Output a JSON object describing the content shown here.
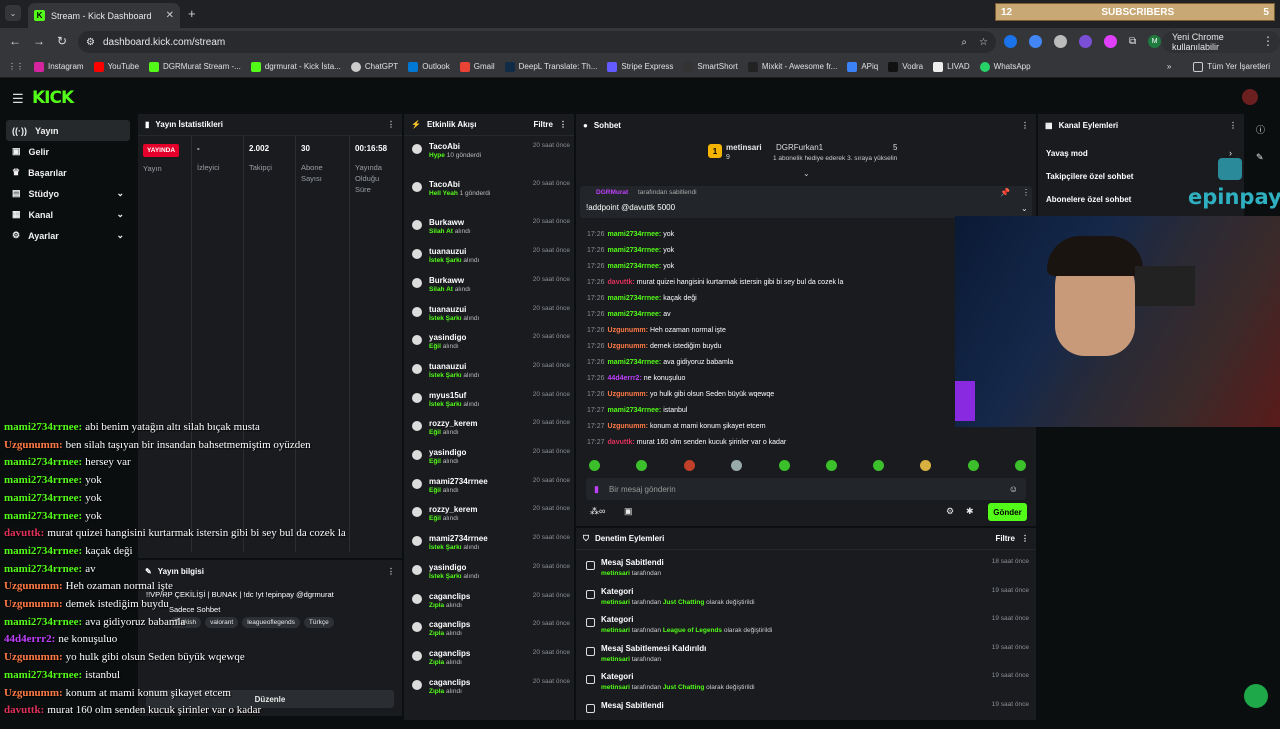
{
  "browser": {
    "tab_title": "Stream - Kick Dashboard",
    "url": "dashboard.kick.com/stream",
    "chrome_user": "Yeni Chrome kullanılabilir",
    "profile_letter": "M",
    "bookmarks": [
      "Instagram",
      "YouTube",
      "DGRMurat Stream -...",
      "dgrmurat - Kick İsta...",
      "ChatGPT",
      "Outlook",
      "Gmail",
      "DeepL Translate: Th...",
      "Stripe Express",
      "SmartShort",
      "Mixkit - Awesome fr...",
      "APiq",
      "Vodra",
      "LIVAD",
      "WhatsApp"
    ],
    "bookmarks_all": "Tüm Yer İşaretleri"
  },
  "overlay_subs": {
    "left": "12",
    "label": "SUBSCRIBERS",
    "right": "5"
  },
  "sidebar": {
    "items": [
      {
        "label": "Yayın"
      },
      {
        "label": "Gelir"
      },
      {
        "label": "Başarılar"
      },
      {
        "label": "Stüdyo"
      },
      {
        "label": "Kanal"
      },
      {
        "label": "Ayarlar"
      }
    ]
  },
  "stats": {
    "title": "Yayın İstatistikleri",
    "live_badge": "YAYINDA",
    "cols": [
      {
        "value": "",
        "label": "Yayın"
      },
      {
        "value": "-",
        "label": "İzleyici"
      },
      {
        "value": "2.002",
        "label": "Takipçi"
      },
      {
        "value": "30",
        "label": "Abone Sayısı"
      },
      {
        "value": "00:16:58",
        "label": "Yayında Olduğu Süre"
      }
    ]
  },
  "stream_info": {
    "title": "Yayın bilgisi",
    "stream_title": "!!VP/RP ÇEKİLİŞİ | BUNAK | !dc !yt !epinpay @dgrmurat",
    "chat_mode": "Sadece Sohbet",
    "tags": [
      "Turkish",
      "valorant",
      "leagueoflegends",
      "Türkçe"
    ],
    "edit_label": "Düzenle"
  },
  "activity": {
    "title": "Etkinlik Akışı",
    "filter": "Filtre",
    "items": [
      {
        "name": "TacoAbi",
        "action": "Hype",
        "extra": "10 gönderdi",
        "time": "20 saat önce"
      },
      {
        "name": "TacoAbi",
        "action": "Hell Yeah",
        "extra": "1 gönderdi",
        "time": "20 saat önce"
      },
      {
        "name": "Burkaww",
        "action": "Silah At",
        "extra": "alındı",
        "time": "20 saat önce"
      },
      {
        "name": "tuanauzui",
        "action": "İstek Şarkı",
        "extra": "alındı",
        "time": "20 saat önce"
      },
      {
        "name": "Burkaww",
        "action": "Silah At",
        "extra": "alındı",
        "time": "20 saat önce"
      },
      {
        "name": "tuanauzui",
        "action": "İstek Şarkı",
        "extra": "alındı",
        "time": "20 saat önce"
      },
      {
        "name": "yasindigo",
        "action": "Eğil",
        "extra": "alındı",
        "time": "20 saat önce"
      },
      {
        "name": "tuanauzui",
        "action": "İstek Şarkı",
        "extra": "alındı",
        "time": "20 saat önce"
      },
      {
        "name": "myus15uf",
        "action": "İstek Şarkı",
        "extra": "alındı",
        "time": "20 saat önce"
      },
      {
        "name": "rozzy_kerem",
        "action": "Eğil",
        "extra": "alındı",
        "time": "20 saat önce"
      },
      {
        "name": "yasindigo",
        "action": "Eğil",
        "extra": "alındı",
        "time": "20 saat önce"
      },
      {
        "name": "mami2734rrnee",
        "action": "Eğil",
        "extra": "alındı",
        "time": "20 saat önce"
      },
      {
        "name": "rozzy_kerem",
        "action": "Eğil",
        "extra": "alındı",
        "time": "20 saat önce"
      },
      {
        "name": "mami2734rrnee",
        "action": "İstek Şarkı",
        "extra": "alındı",
        "time": "20 saat önce"
      },
      {
        "name": "yasindigo",
        "action": "İstek Şarkı",
        "extra": "alındı",
        "time": "20 saat önce"
      },
      {
        "name": "caganclips",
        "action": "Zıpla",
        "extra": "alındı",
        "time": "20 saat önce"
      },
      {
        "name": "caganclips",
        "action": "Zıpla",
        "extra": "alındı",
        "time": "20 saat önce"
      },
      {
        "name": "caganclips",
        "action": "Zıpla",
        "extra": "alındı",
        "time": "20 saat önce"
      },
      {
        "name": "caganclips",
        "action": "Zıpla",
        "extra": "alındı",
        "time": "20 saat önce"
      }
    ]
  },
  "chat": {
    "title": "Sohbet",
    "leader1": {
      "rank": "1",
      "name": "metinsari",
      "count": "9"
    },
    "leader2": {
      "name": "DGRFurkan1",
      "count": "5",
      "desc": "1 abonelik hediye ederek 3. sıraya yükselin"
    },
    "pinned_by": "DGRMurat",
    "pinned_suffix": "tarafından sabitlendi",
    "pinned_msg": "!addpoint @davuttk 5000",
    "messages": [
      {
        "time": "17:26",
        "user": "mami2734rrnee:",
        "text": "yok",
        "color": "#53fc18"
      },
      {
        "time": "17:26",
        "user": "mami2734rrnee:",
        "text": "yok",
        "color": "#53fc18"
      },
      {
        "time": "17:26",
        "user": "mami2734rrnee:",
        "text": "yok",
        "color": "#53fc18"
      },
      {
        "time": "17:26",
        "user": "davuttk:",
        "text": "murat quizei hangisini kurtarmak istersin gibi bi sey bul da cozek la",
        "color": "#e0315a"
      },
      {
        "time": "17:26",
        "user": "mami2734rrnee:",
        "text": "kaçak deği",
        "color": "#53fc18"
      },
      {
        "time": "17:26",
        "user": "mami2734rrnee:",
        "text": "av",
        "color": "#53fc18"
      },
      {
        "time": "17:26",
        "user": "Uzgunumm:",
        "text": "Heh ozaman normal işte",
        "color": "#ff7a45"
      },
      {
        "time": "17:26",
        "user": "Uzgunumm:",
        "text": "demek istediğim buydu",
        "color": "#ff7a45"
      },
      {
        "time": "17:26",
        "user": "mami2734rrnee:",
        "text": "ava gidiyoruz babamla",
        "color": "#53fc18"
      },
      {
        "time": "17:26",
        "user": "44d4errr2:",
        "text": "ne konuşuluo",
        "color": "#c040ff"
      },
      {
        "time": "17:26",
        "user": "Uzgunumm:",
        "text": "yo hulk gibi olsun Seden büyük wqewqe",
        "color": "#ff7a45"
      },
      {
        "time": "17:27",
        "user": "mami2734rrnee:",
        "text": "istanbul",
        "color": "#53fc18"
      },
      {
        "time": "17:27",
        "user": "Uzgunumm:",
        "text": "konum at mami konum şikayet etcem",
        "color": "#ff7a45"
      },
      {
        "time": "17:27",
        "user": "davuttk:",
        "text": "murat 160 olm senden kucuk şirinler var o kadar",
        "color": "#e0315a"
      }
    ],
    "input_placeholder": "Bir mesaj gönderin",
    "send_label": "Gönder"
  },
  "overlay_chat": [
    {
      "user": "mami2734rrnee:",
      "text": "abi benim yatağın altı silah bıçak musta",
      "color": "#53fc18"
    },
    {
      "user": "Uzgunumm:",
      "text": "ben silah taşıyan bir insandan bahsetmemiştim oyüzden",
      "color": "#ff7a45"
    },
    {
      "user": "mami2734rrnee:",
      "text": "hersey var",
      "color": "#53fc18"
    },
    {
      "user": "mami2734rrnee:",
      "text": "yok",
      "color": "#53fc18"
    },
    {
      "user": "mami2734rrnee:",
      "text": "yok",
      "color": "#53fc18"
    },
    {
      "user": "mami2734rrnee:",
      "text": "yok",
      "color": "#53fc18"
    },
    {
      "user": "davuttk:",
      "text": "murat quizei hangisini kurtarmak istersin gibi bi sey bul da cozek la",
      "color": "#e0315a"
    },
    {
      "user": "mami2734rrnee:",
      "text": "kaçak deği",
      "color": "#53fc18"
    },
    {
      "user": "mami2734rrnee:",
      "text": "av",
      "color": "#53fc18"
    },
    {
      "user": "Uzgunumm:",
      "text": "Heh ozaman normal işte",
      "color": "#ff7a45"
    },
    {
      "user": "Uzgunumm:",
      "text": "demek istediğim buydu",
      "color": "#ff7a45"
    },
    {
      "user": "mami2734rrnee:",
      "text": "ava gidiyoruz babamla",
      "color": "#53fc18"
    },
    {
      "user": "44d4errr2:",
      "text": "ne konuşuluo",
      "color": "#c040ff"
    },
    {
      "user": "Uzgunumm:",
      "text": "yo hulk gibi olsun Seden büyük wqewqe",
      "color": "#ff7a45"
    },
    {
      "user": "mami2734rrnee:",
      "text": "istanbul",
      "color": "#53fc18"
    },
    {
      "user": "Uzgunumm:",
      "text": "konum at mami konum şikayet etcem",
      "color": "#ff7a45"
    },
    {
      "user": "davuttk:",
      "text": "murat 160 olm senden kucuk şirinler var o kadar",
      "color": "#e0315a"
    }
  ],
  "moderation": {
    "title": "Denetim Eylemleri",
    "filter": "Filtre",
    "items": [
      {
        "title": "Mesaj Sabitlendi",
        "user": "metinsari",
        "mid": "tarafından",
        "value": "",
        "tail": "",
        "time": "18 saat önce"
      },
      {
        "title": "Kategori",
        "user": "metinsari",
        "mid": "tarafından",
        "value": "Just Chatting",
        "tail": "olarak değiştirildi",
        "time": "19 saat önce"
      },
      {
        "title": "Kategori",
        "user": "metinsari",
        "mid": "tarafından",
        "value": "League of Legends",
        "tail": "olarak değiştirildi",
        "time": "19 saat önce"
      },
      {
        "title": "Mesaj Sabitlemesi Kaldırıldı",
        "user": "metinsari",
        "mid": "tarafından",
        "value": "",
        "tail": "",
        "time": "19 saat önce"
      },
      {
        "title": "Kategori",
        "user": "metinsari",
        "mid": "tarafından",
        "value": "Just Chatting",
        "tail": "olarak değiştirildi",
        "time": "19 saat önce"
      },
      {
        "title": "Mesaj Sabitlendi",
        "user": "",
        "mid": "",
        "value": "",
        "tail": "",
        "time": "19 saat önce"
      }
    ]
  },
  "channel_actions": {
    "title": "Kanal Eylemleri",
    "items": [
      "Yavaş mod",
      "Takipçilere özel sohbet",
      "Abonelere özel sohbet"
    ]
  },
  "sponsor_logo": "epinpay"
}
